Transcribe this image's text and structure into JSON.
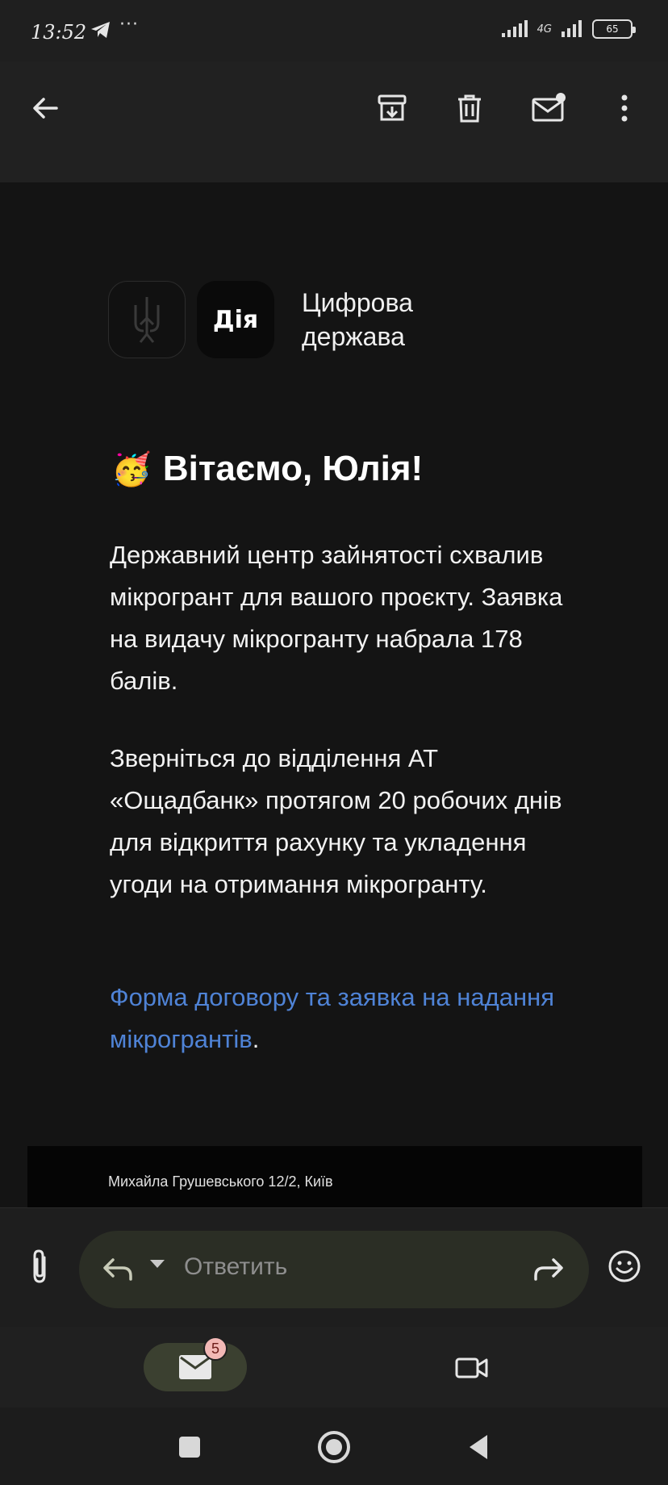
{
  "status_bar": {
    "time": "13:52",
    "more": "···",
    "network_label": "4G",
    "battery": "65"
  },
  "toolbar": {
    "back_icon": "arrow-left-icon",
    "archive_icon": "archive-icon",
    "delete_icon": "trash-icon",
    "mark_unread_icon": "mail-unread-icon",
    "more_icon": "more-vert-icon"
  },
  "email": {
    "logo_text": "Дія",
    "brand_name": "Цифрова держава",
    "greeting_emoji": "🥳",
    "greeting": "Вітаємо, Юлія!",
    "paragraph1": "Державний центр зайнятості схвалив мікрогрант для вашого проєкту. Заявка на видачу мікрогранту набрала 178 балів.",
    "paragraph2": "Зверніться до відділення АТ «Ощадбанк» протягом 20 робочих днів для відкриття рахунку та укладення угоди на отримання мікрогранту.",
    "link_text": "Форма договору та заявка на надання мікрогрантів",
    "link_suffix": ".",
    "footer_address": "Михайла Грушевського 12/2, Київ"
  },
  "reply": {
    "placeholder": "Ответить"
  },
  "bottom_nav": {
    "mail_badge": "5"
  },
  "colors": {
    "link": "#4f83d6",
    "background": "#141414",
    "badge": "#f2b8b5"
  }
}
